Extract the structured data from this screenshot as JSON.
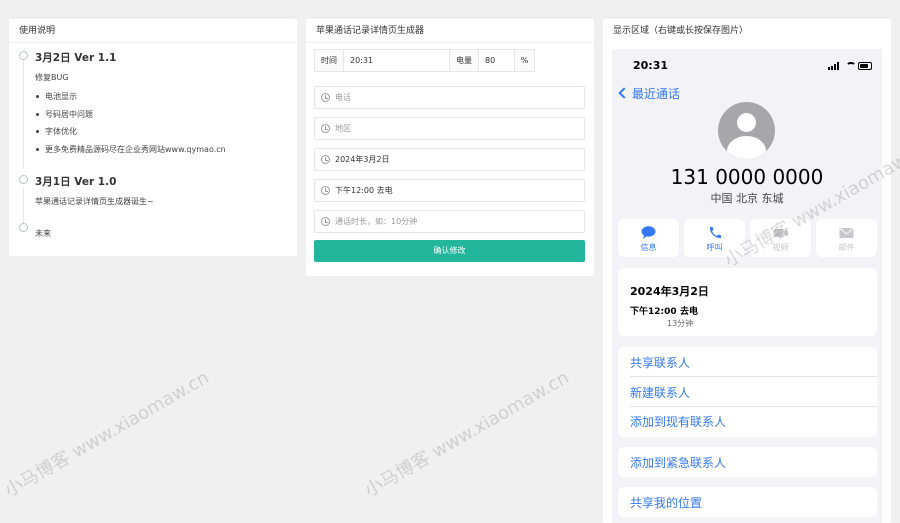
{
  "left_panel": {
    "title": "使用说明",
    "entries": [
      {
        "heading": "3月2日 Ver 1.1",
        "note": "修复BUG",
        "items": [
          "电池显示",
          "号码居中问题",
          "字体优化",
          "更多免费精品源码尽在企业秀网站www.qymao.cn"
        ]
      },
      {
        "heading": "3月1日 Ver 1.0",
        "note": "苹果通话记录详情页生成器诞生~"
      },
      {
        "heading": "",
        "note": "未来"
      }
    ]
  },
  "mid_panel": {
    "title": "苹果通话记录详情页生成器",
    "time_label": "时间",
    "time_value": "20:31",
    "battery_label": "电量",
    "battery_value": "80",
    "battery_unit": "%",
    "phone_placeholder": "电话",
    "region_placeholder": "地区",
    "date_value": "2024年3月2日",
    "call_time_value": "下午12:00 去电",
    "duration_placeholder": "通话时长，如：10分钟",
    "confirm_label": "确认修改"
  },
  "right_panel": {
    "title": "显示区域（右键或长按保存图片）",
    "phone": {
      "status_time": "20:31",
      "back_label": "最近通话",
      "number": "131 0000 0000",
      "region": "中国 北京 东城",
      "actions": [
        {
          "label": "信息",
          "icon": "message-icon",
          "enabled": true
        },
        {
          "label": "呼叫",
          "icon": "phone-icon",
          "enabled": true
        },
        {
          "label": "视频",
          "icon": "video-icon",
          "enabled": false
        },
        {
          "label": "邮件",
          "icon": "mail-icon",
          "enabled": false
        }
      ],
      "call_date": "2024年3月2日",
      "call_time": "下午12:00",
      "call_direction": "去电",
      "call_duration": "13分钟",
      "links": [
        "共享联系人",
        "新建联系人",
        "添加到现有联系人",
        "添加到紧急联系人",
        "共享我的位置"
      ],
      "battery_level": 0.8
    }
  },
  "watermark": "小马博客 www.xiaomaw.cn",
  "colors": {
    "accent": "#22b69d",
    "ios_blue": "#3478f6"
  }
}
